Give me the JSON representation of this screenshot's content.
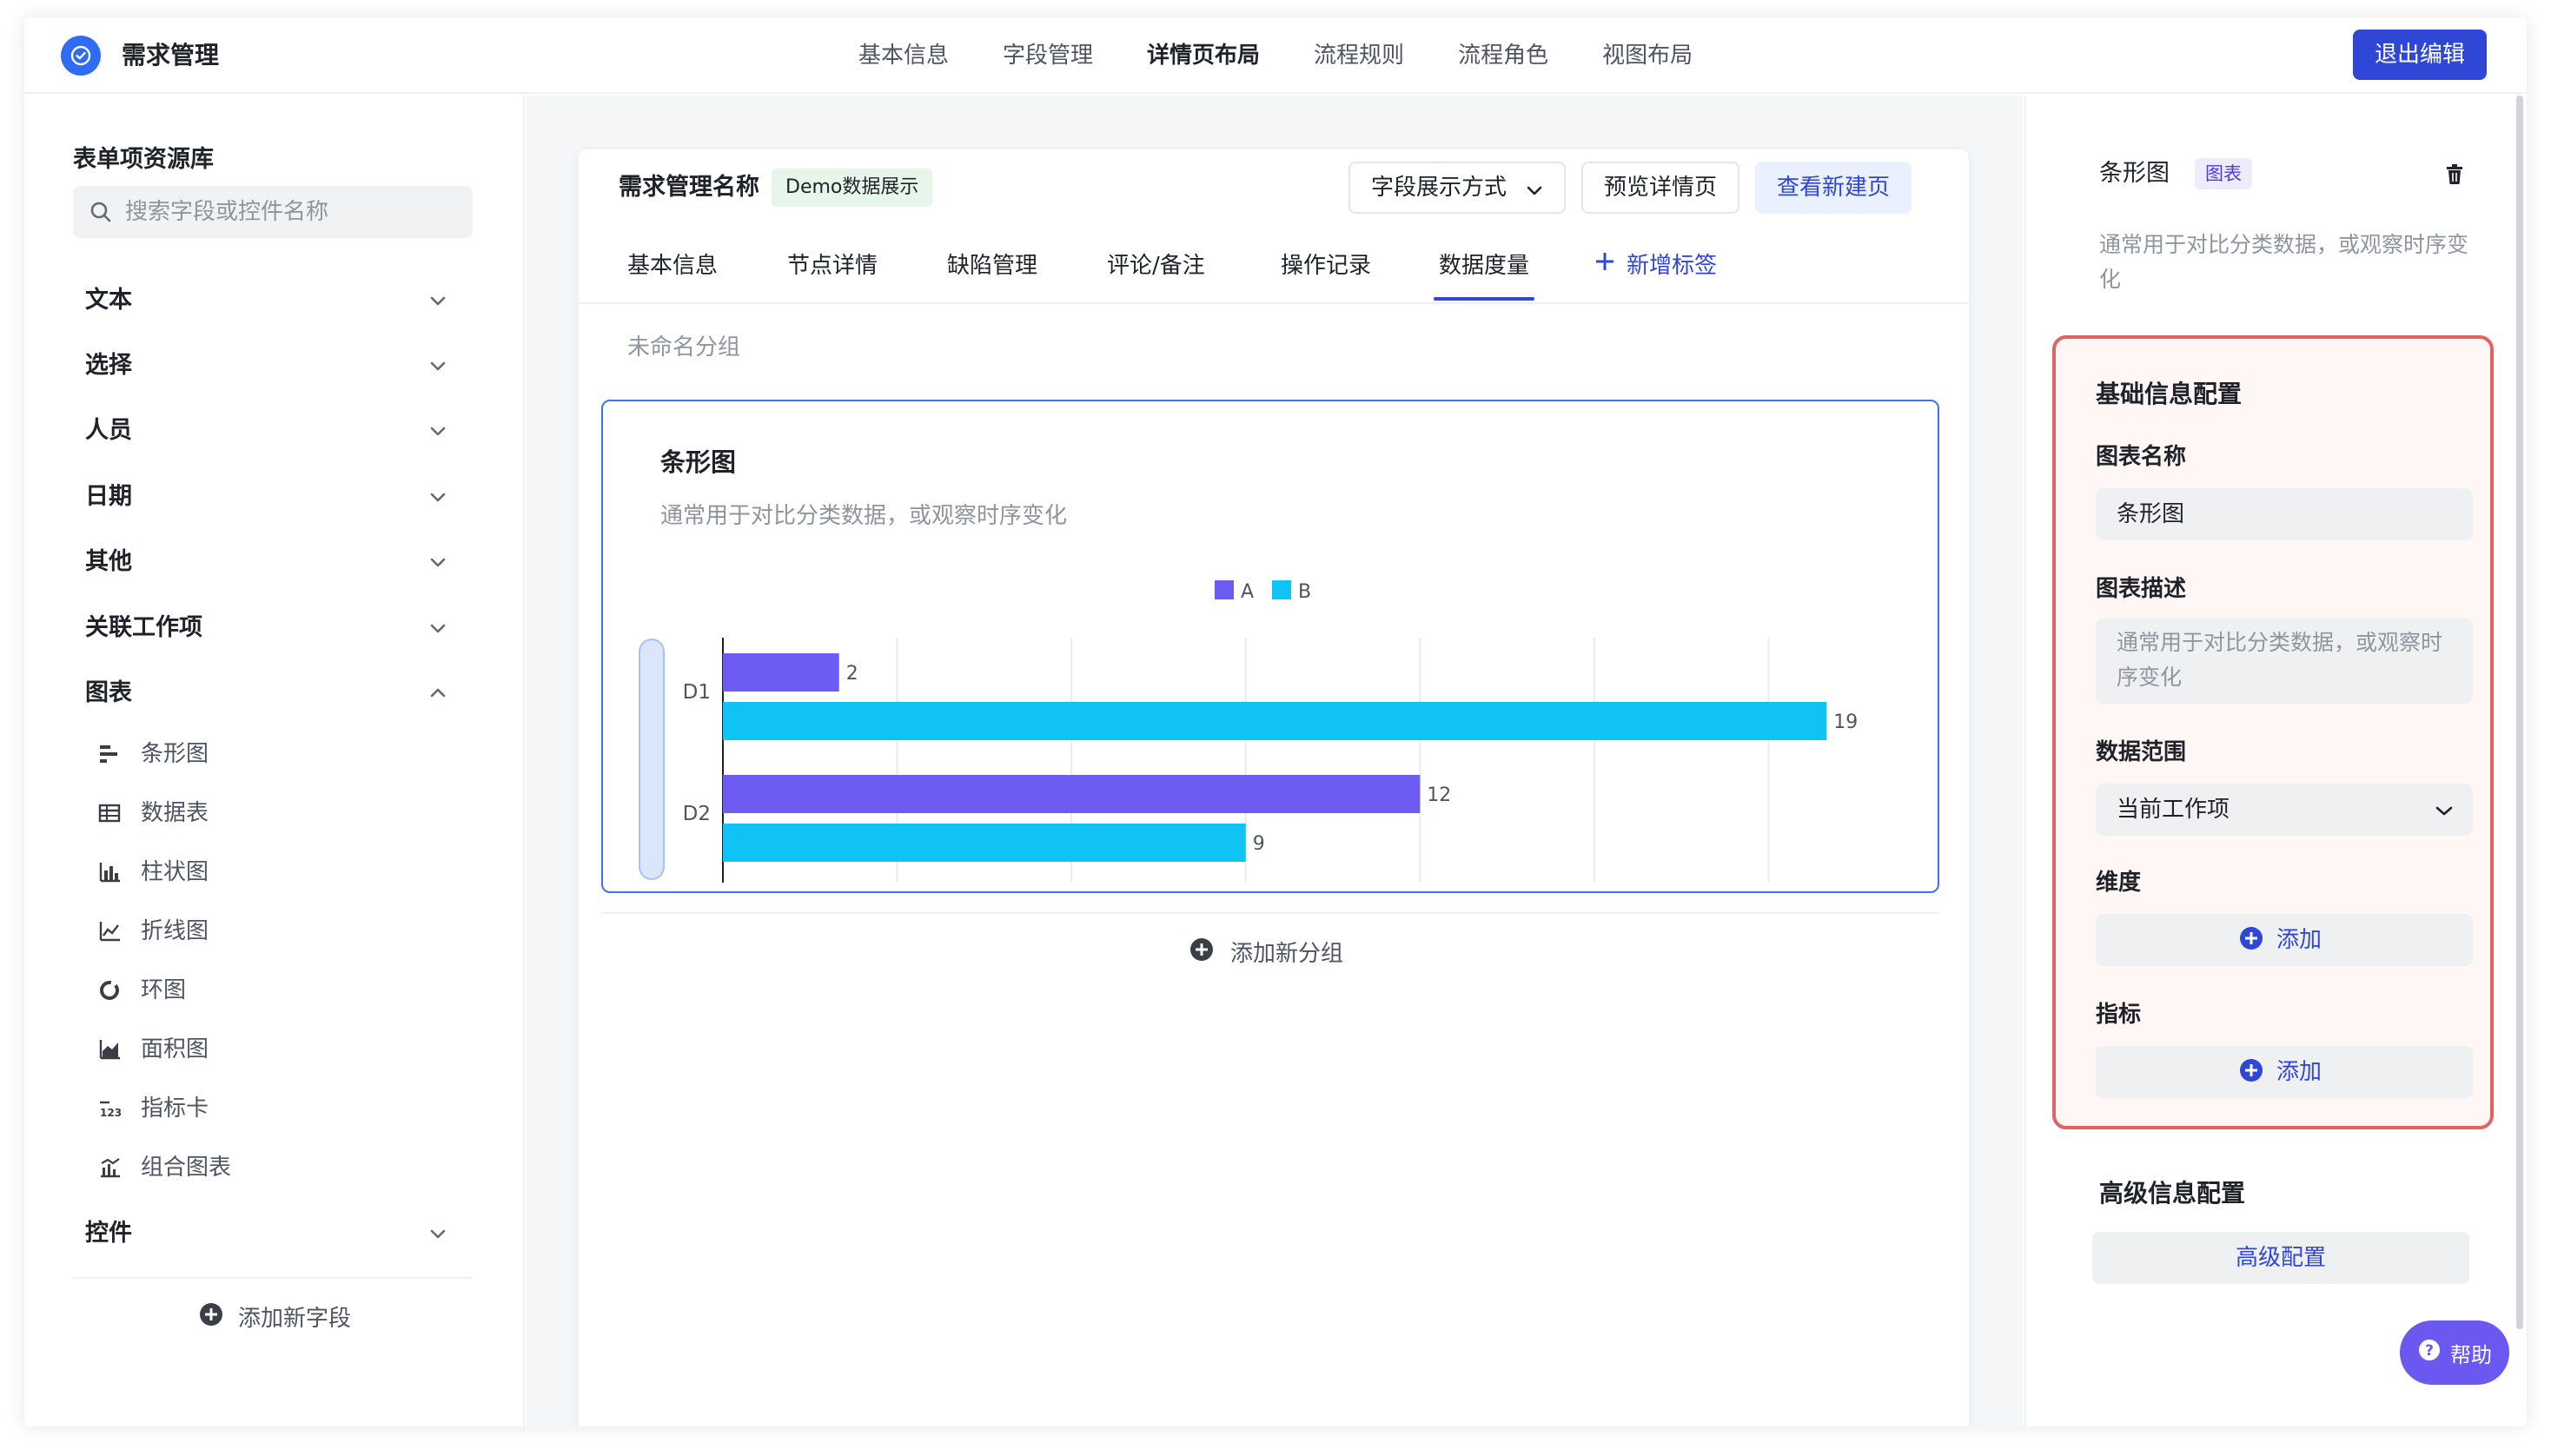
{
  "header": {
    "app_title": "需求管理",
    "nav": [
      "基本信息",
      "字段管理",
      "详情页布局",
      "流程规则",
      "流程角色",
      "视图布局"
    ],
    "active_nav": "详情页布局",
    "exit_label": "退出编辑"
  },
  "sidebar": {
    "title": "表单项资源库",
    "search_placeholder": "搜索字段或控件名称",
    "categories": [
      "文本",
      "选择",
      "人员",
      "日期",
      "其他",
      "关联工作项",
      "图表",
      "控件"
    ],
    "chart_items": [
      "条形图",
      "数据表",
      "柱状图",
      "折线图",
      "环图",
      "面积图",
      "指标卡",
      "组合图表"
    ],
    "add_field_label": "添加新字段"
  },
  "card": {
    "title": "需求管理名称",
    "badge": "Demo数据展示",
    "field_display_label": "字段展示方式",
    "preview_label": "预览详情页",
    "new_page_label": "查看新建页",
    "tabs": [
      "基本信息",
      "节点详情",
      "缺陷管理",
      "评论/备注",
      "操作记录",
      "数据度量"
    ],
    "active_tab": "数据度量",
    "add_tab_label": "新增标签",
    "group_name": "未命名分组",
    "add_group_label": "添加新分组"
  },
  "chart_data": {
    "type": "bar",
    "orientation": "horizontal",
    "title": "条形图",
    "subtitle": "通常用于对比分类数据，或观察时序变化",
    "categories": [
      "D1",
      "D2"
    ],
    "series": [
      {
        "name": "A",
        "values": [
          2,
          12
        ],
        "color": "#6d5cf2"
      },
      {
        "name": "B",
        "values": [
          19,
          9
        ],
        "color": "#0fc3f5"
      }
    ],
    "xlim": [
      0,
      21
    ],
    "xticks": [
      0,
      3,
      6,
      9,
      12,
      15,
      18,
      21
    ],
    "grid": true,
    "legend": "top-center"
  },
  "right_panel": {
    "component_name": "条形图",
    "component_type": "图表",
    "component_desc": "通常用于对比分类数据，或观察时序变化",
    "basic_config_title": "基础信息配置",
    "chart_name_label": "图表名称",
    "chart_name_value": "条形图",
    "chart_desc_label": "图表描述",
    "chart_desc_placeholder": "通常用于对比分类数据，或观察时序变化",
    "data_range_label": "数据范围",
    "data_range_value": "当前工作项",
    "dimension_label": "维度",
    "metric_label": "指标",
    "add_label": "添加",
    "advanced_title": "高级信息配置",
    "advanced_button": "高级配置",
    "help_label": "帮助"
  }
}
